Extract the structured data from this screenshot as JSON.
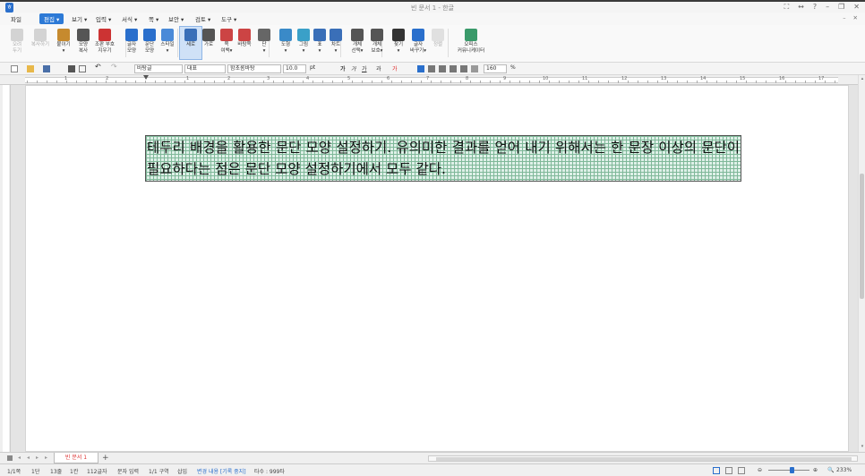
{
  "window": {
    "title": "빈 문서 1 - 한글",
    "app_icon_label": "ㅎ",
    "controls": [
      "⛶",
      "↔",
      "?",
      "–",
      "❐",
      "✕"
    ]
  },
  "menu": {
    "file": "파일",
    "items": [
      "편집 ▾",
      "보기 ▾",
      "입력 ▾",
      "서식 ▾",
      "쪽 ▾",
      "보안 ▾",
      "검토 ▾",
      "도구 ▾"
    ],
    "active_index": 0,
    "right": [
      "–",
      "✕"
    ]
  },
  "ribbon": {
    "buttons": [
      {
        "label": "오려\n두기",
        "icon": "scissors-icon",
        "disabled": true
      },
      {
        "label": "복사하기",
        "icon": "copy-icon",
        "disabled": true
      },
      {
        "label": "붙이기\n▾",
        "icon": "paste-icon",
        "disabled": false
      },
      {
        "label": "모양\n복사",
        "icon": "format-painter-icon",
        "disabled": false
      },
      {
        "label": "조판 부호\n지우기",
        "icon": "clear-codes-icon",
        "disabled": false
      },
      {
        "label": "글자\n모양",
        "icon": "char-shape-icon",
        "disabled": false
      },
      {
        "label": "문단\n모양",
        "icon": "para-shape-icon",
        "disabled": false
      },
      {
        "label": "스타일\n▾",
        "icon": "style-icon",
        "disabled": false
      },
      {
        "label": "세로",
        "icon": "portrait-icon",
        "disabled": false,
        "selected": true
      },
      {
        "label": "가로",
        "icon": "landscape-icon",
        "disabled": false
      },
      {
        "label": "쪽\n여백▾",
        "icon": "margin-icon",
        "disabled": false
      },
      {
        "label": "바탕쪽",
        "icon": "master-page-icon",
        "disabled": false
      },
      {
        "label": "단\n▾",
        "icon": "columns-icon",
        "disabled": false
      },
      {
        "label": "도형\n▾",
        "icon": "shape-icon",
        "disabled": false
      },
      {
        "label": "그림\n▾",
        "icon": "picture-icon",
        "disabled": false
      },
      {
        "label": "표\n▾",
        "icon": "table-icon",
        "disabled": false
      },
      {
        "label": "차트\n▾",
        "icon": "chart-icon",
        "disabled": false
      },
      {
        "label": "개체\n선택▾",
        "icon": "object-select-icon",
        "disabled": false
      },
      {
        "label": "개체\n보호▾",
        "icon": "object-protect-icon",
        "disabled": false
      },
      {
        "label": "찾기\n▾",
        "icon": "find-icon",
        "disabled": false
      },
      {
        "label": "글자\n바꾸기▾",
        "icon": "replace-icon",
        "disabled": false
      },
      {
        "label": "정렬",
        "icon": "sort-icon",
        "disabled": true
      },
      {
        "label": "오피스\n커뮤니케이터",
        "icon": "office-communicator-icon",
        "disabled": false
      }
    ]
  },
  "format_toolbar": {
    "style": "바탕글",
    "lang": "대표",
    "font": "함초롬바탕",
    "size": "10.0",
    "unit": "pt",
    "bold": "가",
    "italic": "가",
    "underline": "가",
    "strike": "과",
    "color": "가",
    "line_spacing": "160",
    "percent": "%"
  },
  "ruler": {
    "numbers": [
      "1",
      "2",
      "1",
      "2",
      "3",
      "4",
      "5",
      "6",
      "7",
      "8",
      "9",
      "10",
      "11",
      "12",
      "13",
      "14",
      "15",
      "16",
      "17"
    ]
  },
  "document": {
    "paragraph": "테두리 배경을 활용한 문단 모양 설정하기. 유의미한 결과를 얻어 내기 위해서는 한 문장 이상의 문단이 필요하다는 점은 문단 모양 설정하기에서 모두 같다."
  },
  "tabs": {
    "nav": [
      "◂",
      "◂",
      "▸",
      "▸"
    ],
    "doc_tab": "빈 문서 1",
    "add": "+"
  },
  "status": {
    "page": "1/1쪽",
    "section": "1단",
    "line": "13줄",
    "col": "1칸",
    "chars": "112글자",
    "mode": "문자 입력",
    "area": "1/1 구역",
    "insert": "삽입",
    "track": "변경 내용 [기록 중지]",
    "typing": "타수 : 999타",
    "zoom": "233%"
  },
  "colors": {
    "accent": "#2d7ad6",
    "grid_line": "#7fb899",
    "grid_bg": "#dff0e8"
  }
}
